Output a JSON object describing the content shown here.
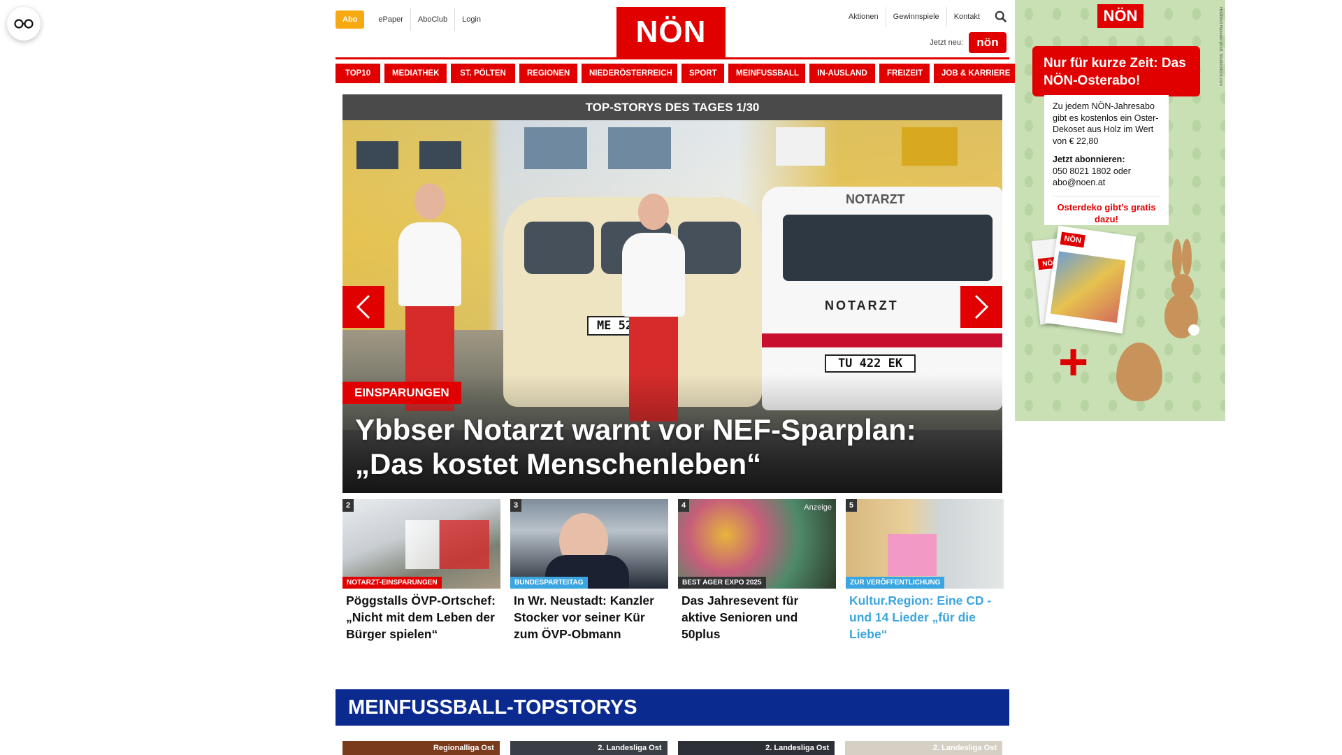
{
  "accessibility": {
    "icon": "glasses-icon"
  },
  "header": {
    "abo_label": "Abo",
    "util_links": [
      "ePaper",
      "AboClub",
      "Login"
    ],
    "logo_text": "NÖN",
    "right_links": [
      "Aktionen",
      "Gewinnspiele",
      "Kontakt"
    ],
    "jetzt_neu_label": "Jetzt neu:",
    "jetzt_badge": "nön"
  },
  "nav": {
    "items": [
      "TOP10",
      "MEDIATHEK",
      "ST. PÖLTEN",
      "REGIONEN",
      "NIEDERÖSTERREICH",
      "SPORT",
      "MEINFUSSBALL",
      "IN-AUSLAND",
      "FREIZEIT",
      "JOB & KARRIERE"
    ]
  },
  "hero": {
    "header": "TOP-STORYS DES TAGES 1/30",
    "kicker": "EINSPARUNGEN",
    "title": "Ybbser Notarzt warnt vor NEF-Sparplan: „Das kostet Menschenleben“",
    "plate_left": "ME 525 EF",
    "plate_right": "TU 422 EK",
    "vehicle_label": "NOTARZT"
  },
  "teasers": [
    {
      "num": "2",
      "tag": "NOTARZT-EINSPARUNGEN",
      "tag_color": "#e10000",
      "title": "Pöggstalls ÖVP-Ortschef: „Nicht mit dem Leben der Bürger spielen“",
      "anzeige": ""
    },
    {
      "num": "3",
      "tag": "BUNDESPARTEITAG",
      "tag_color": "#3aa5e0",
      "title": "In Wr. Neustadt: Kanzler Stocker vor seiner Kür zum ÖVP-Obmann",
      "anzeige": ""
    },
    {
      "num": "4",
      "tag": "BEST AGER EXPO 2025",
      "tag_color": "#333333",
      "title": "Das Jahresevent für aktive Senioren und 50plus",
      "anzeige": "Anzeige"
    },
    {
      "num": "5",
      "tag": "ZUR VERÖFFENTLICHUNG",
      "tag_color": "#3aa5e0",
      "title": "Kultur.Region: Eine CD - und 14 Lieder „für die Liebe“",
      "anzeige": ""
    }
  ],
  "football": {
    "header": "MEINFUSSBALL-TOPSTORYS",
    "cards": [
      "Regionalliga Ost",
      "2. Landesliga Ost",
      "2. Landesliga Ost",
      "2. Landesliga Ost"
    ]
  },
  "ad": {
    "logo": "NÖN",
    "credit": "Holzbrett Hasenei (kraft: Shutterstock.com",
    "banner": "Nur für kurze Zeit: Das NÖN-Osterabo!",
    "text1": "Zu jedem NÖN-Jahresabo gibt es kostenlos ein Oster-Dekoset aus Holz im Wert von € 22,80",
    "text2_bold": "Jetzt abonnieren:",
    "text2": "050 8021 1802 oder abo@noen.at",
    "red_text": "Osterdeko gibt’s gratis dazu!",
    "plus": "+"
  },
  "colors": {
    "brand_red": "#e10000",
    "abo_orange": "#f7a912",
    "football_blue": "#0b2a8f",
    "teaser_blue": "#3aa5e0"
  }
}
